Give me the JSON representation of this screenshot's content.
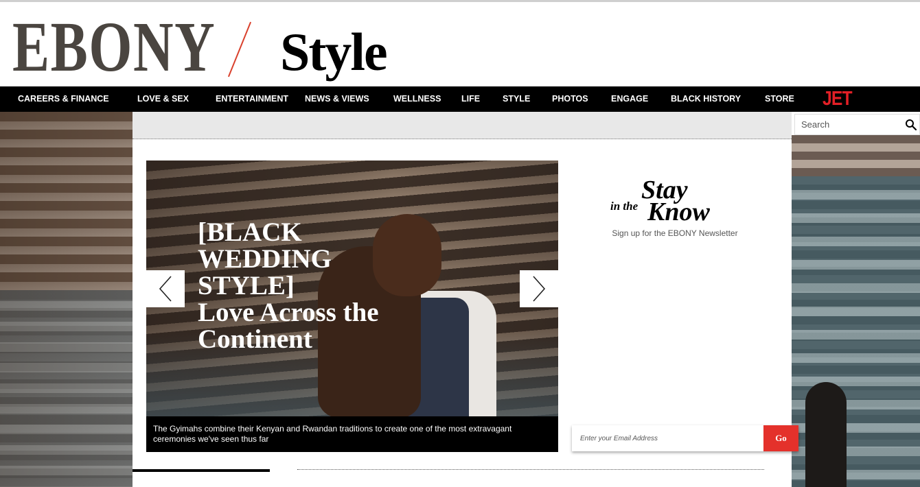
{
  "header": {
    "logo_primary": "EBONY",
    "logo_section": "Style"
  },
  "nav": {
    "items": [
      {
        "label": "CAREERS & FINANCE"
      },
      {
        "label": "LOVE & SEX"
      },
      {
        "label": "ENTERTAINMENT"
      },
      {
        "label": "NEWS & VIEWS"
      },
      {
        "label": "WELLNESS"
      },
      {
        "label": "LIFE"
      },
      {
        "label": "STYLE"
      },
      {
        "label": "PHOTOS"
      },
      {
        "label": "ENGAGE"
      },
      {
        "label": "BLACK HISTORY"
      },
      {
        "label": "STORE"
      }
    ],
    "jet_logo": "JET"
  },
  "search": {
    "placeholder": "Search"
  },
  "slider": {
    "title_line1": "[BLACK WEDDING STYLE]",
    "title_line2": "Love Across the Continent",
    "caption": "The Gyimahs combine their Kenyan and Rwandan traditions to create one of the most extravagant ceremonies we've seen thus far"
  },
  "newsletter": {
    "stay": "Stay",
    "in_the": "in the",
    "know": "Know",
    "subtitle": "Sign up for the EBONY Newsletter",
    "email_placeholder": "Enter your Email Address",
    "go_label": "Go"
  },
  "colors": {
    "accent_red": "#e4312b",
    "nav_bg": "#000000"
  }
}
